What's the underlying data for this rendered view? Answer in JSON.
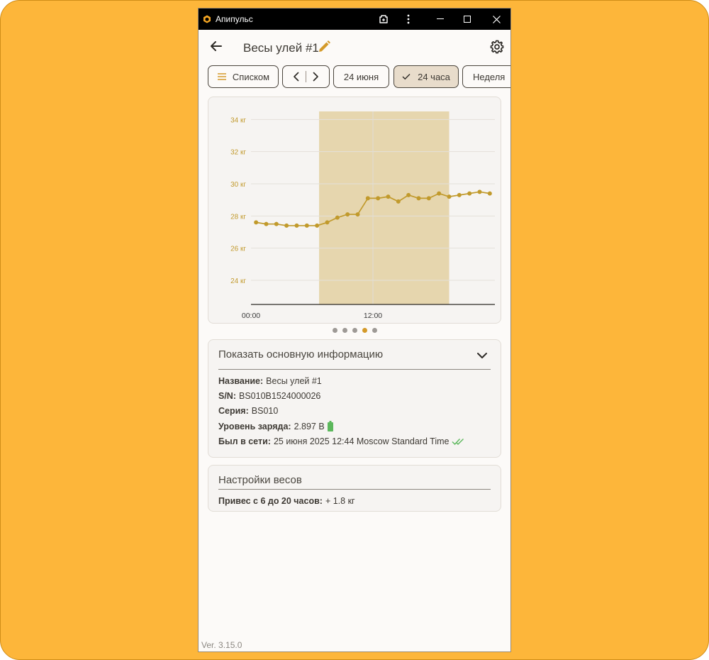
{
  "window": {
    "app_name": "Апипульс",
    "controls": [
      "restore-app-icon",
      "more-icon",
      "minimize-icon",
      "maximize-icon",
      "close-icon"
    ]
  },
  "header": {
    "title": "Весы улей #1"
  },
  "toolbar": {
    "list_label": "Списком",
    "date_label": "24 июня",
    "period_24h_label": "24 часа",
    "week_label": "Неделя"
  },
  "chart_data": {
    "type": "line",
    "title": "",
    "xlabel": "",
    "ylabel": "",
    "y_tick_labels": [
      "34 кг",
      "32 кг",
      "30 кг",
      "28 кг",
      "26 кг",
      "24 кг"
    ],
    "y_ticks": [
      34,
      32,
      30,
      28,
      26,
      24
    ],
    "x_tick_labels": [
      "00:00",
      "12:00"
    ],
    "ylim": [
      22.5,
      34.5
    ],
    "xlim": [
      0,
      24
    ],
    "grid": true,
    "x": [
      0.5,
      1.5,
      2.5,
      3.5,
      4.5,
      5.5,
      6.5,
      7.5,
      8.5,
      9.5,
      10.5,
      11.5,
      12.5,
      13.5,
      14.5,
      15.5,
      16.5,
      17.5,
      18.5,
      19.5,
      20.5,
      21.5,
      22.5,
      23.5
    ],
    "values": [
      27.6,
      27.5,
      27.5,
      27.4,
      27.4,
      27.4,
      27.4,
      27.6,
      27.9,
      28.1,
      28.1,
      29.1,
      29.1,
      29.2,
      28.9,
      29.3,
      29.1,
      29.1,
      29.4,
      29.2,
      29.3,
      29.4,
      29.5,
      29.4
    ],
    "shaded_range": [
      6.7,
      19.5
    ],
    "colors": {
      "line": "#c19a2c",
      "fill": "#e6d6ae",
      "tick_y": "#c29a2e",
      "tick_x": "#3a3a3a"
    }
  },
  "pager": {
    "count": 5,
    "active": 3
  },
  "info": {
    "header": "Показать основную информацию",
    "name_label": "Название:",
    "name_value": "Весы улей #1",
    "sn_label": "S/N:",
    "sn_value": "BS010B1524000026",
    "series_label": "Серия:",
    "series_value": "BS010",
    "charge_label": "Уровень заряда:",
    "charge_value": "2.897 В",
    "online_label": "Был в сети:",
    "online_value": "25 июня 2025 12:44 Moscow Standard Time"
  },
  "settings": {
    "header": "Настройки весов",
    "gain_label": "Привес с 6 до 20 часов:",
    "gain_value": "+ 1.8 кг"
  },
  "footer": {
    "version": "Ver. 3.15.0"
  },
  "colors": {
    "accent": "#d49a2a",
    "background": "#fdb63a",
    "battery": "#5cb85c",
    "check": "#5cb85c"
  }
}
